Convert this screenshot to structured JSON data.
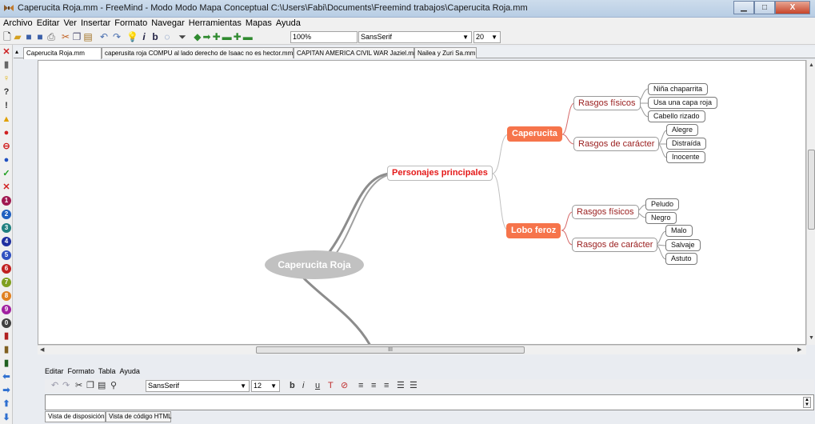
{
  "window": {
    "title": "Caperucita Roja.mm - FreeMind - Modo Modo Mapa Conceptual C:\\Users\\Fabi\\Documents\\Freemind trabajos\\Caperucita Roja.mm",
    "minimize": "▁",
    "maximize": "□",
    "close": "X"
  },
  "menu": [
    "Archivo",
    "Editar",
    "Ver",
    "Insertar",
    "Formato",
    "Navegar",
    "Herramientas",
    "Mapas",
    "Ayuda"
  ],
  "toolbar": {
    "zoom": "100%",
    "font": "SansSerif",
    "font_size": "20"
  },
  "tabs": [
    "Caperucita Roja.mm",
    "caperusita roja COMPU al lado derecho de Isaac no es hector.mm",
    "CAPITAN AMERICA CIVIL WAR Jaziel.mm",
    "Nailea y Zuri Sa.mm"
  ],
  "map": {
    "root": "Caperucita Roja",
    "main_topic": "Personajes principales",
    "characters": [
      {
        "name": "Caperucita",
        "groups": [
          {
            "label": "Rasgos físicos",
            "leaves": [
              "Niña chaparrita",
              "Usa una capa roja",
              "Cabello rizado"
            ]
          },
          {
            "label": "Rasgos de carácter",
            "leaves": [
              "Alegre",
              "Distraída",
              "Inocente"
            ]
          }
        ]
      },
      {
        "name": "Lobo feroz",
        "groups": [
          {
            "label": "Rasgos físicos",
            "leaves": [
              "Peludo",
              "Negro"
            ]
          },
          {
            "label": "Rasgos de carácter",
            "leaves": [
              "Malo",
              "Salvaje",
              "Astuto"
            ]
          }
        ]
      }
    ]
  },
  "editor": {
    "menu": [
      "Editar",
      "Formato",
      "Tabla",
      "Ayuda"
    ],
    "font": "SansSerif",
    "font_size": "12",
    "tabs": [
      "Vista de disposición",
      "Vista de código HTML"
    ]
  },
  "colors": {
    "orange_node": "#f6744b",
    "main_topic_text": "#e41a1a",
    "subtopic_text": "#9b2020",
    "root_fill": "#c1c1c1",
    "edge_red": "#d66a6a"
  },
  "icons": [
    "freemind-app-icon",
    "new-icon",
    "open-icon",
    "save-icon",
    "save-as-icon",
    "print-icon",
    "cut-icon",
    "copy-icon",
    "paste-icon",
    "undo-icon",
    "redo-icon",
    "idea-icon",
    "italic-icon",
    "bold-icon",
    "cloud-icon",
    "filter-icon",
    "navigate-arrows-icon",
    "editor-undo-icon",
    "editor-redo-icon",
    "editor-cut-icon",
    "editor-copy-icon",
    "editor-paste-icon",
    "editor-find-icon",
    "editor-bold-icon",
    "editor-italic-icon",
    "editor-underline-icon",
    "editor-color-icon",
    "editor-clear-icon",
    "align-left-icon",
    "align-center-icon",
    "align-right-icon",
    "bullet-list-icon",
    "numbered-list-icon"
  ],
  "scroll": {
    "horizontal_grip": "III"
  }
}
